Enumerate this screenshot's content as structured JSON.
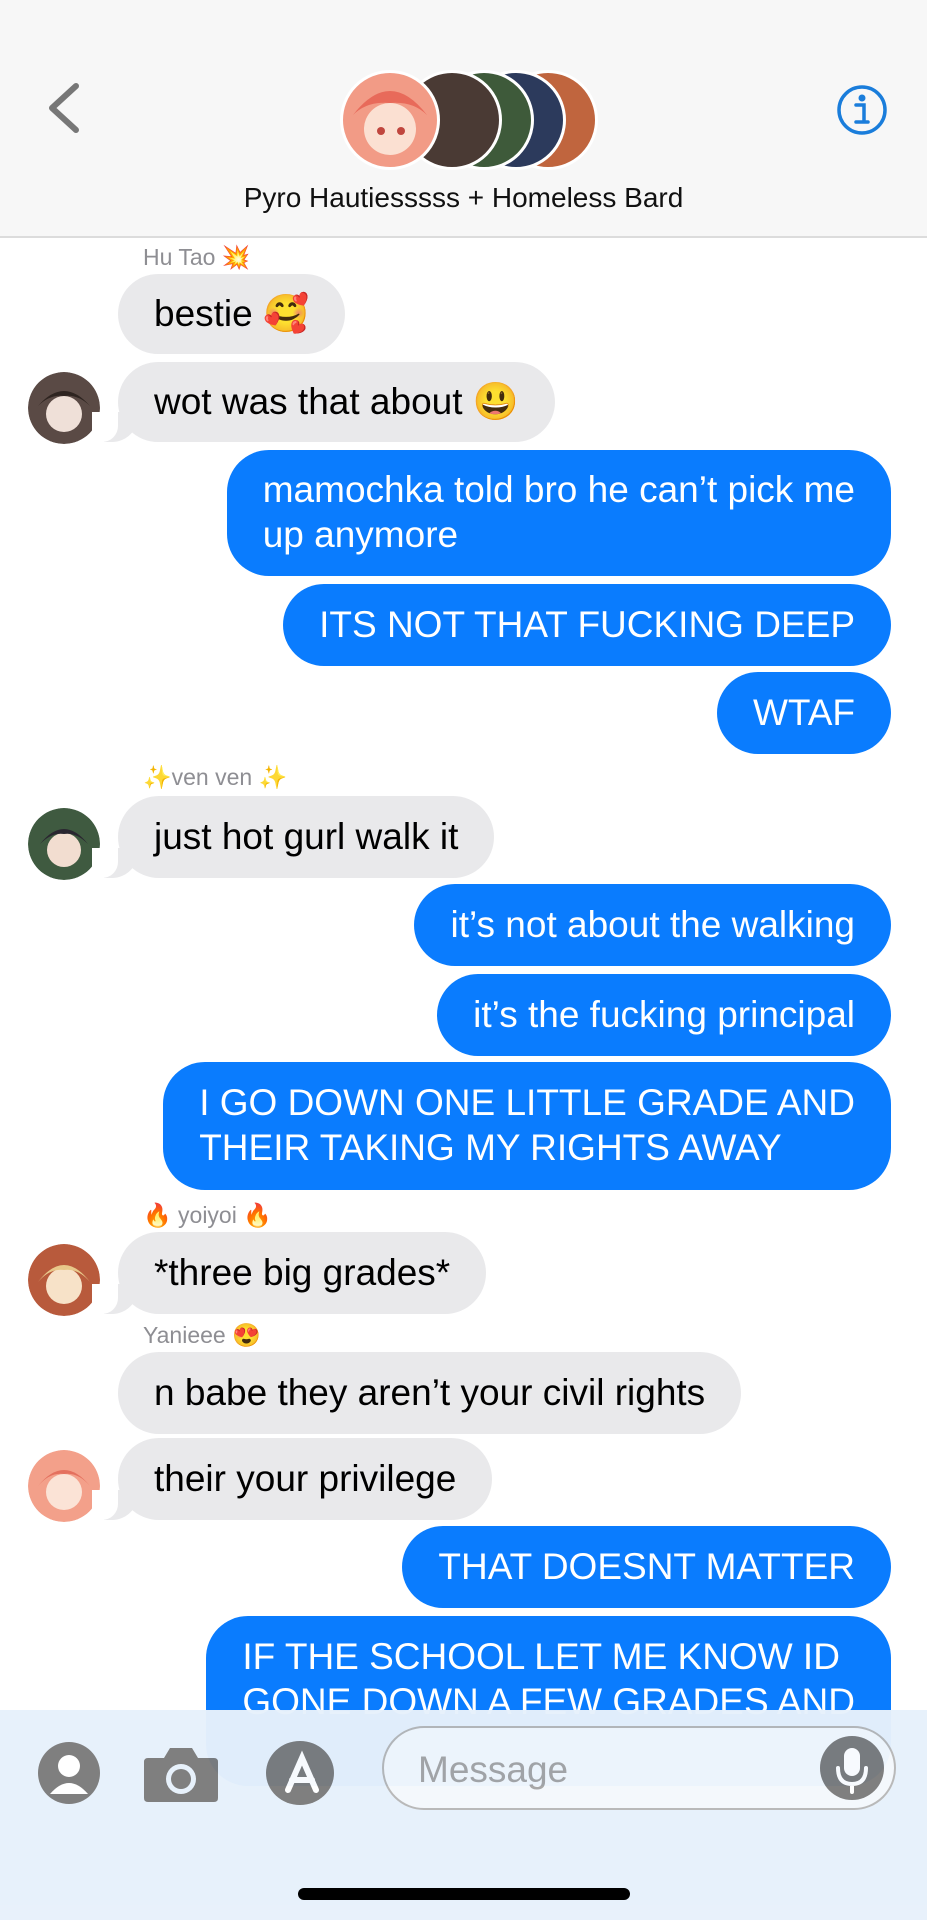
{
  "header": {
    "title": "Pyro Hautiesssss + Homeless Bard",
    "back_icon": "chevron-left-icon",
    "info_icon": "info-icon",
    "accent": "#1a7ddb"
  },
  "colors": {
    "outgoing": "#0a7cfe",
    "incoming": "#e9e9eb",
    "sender_label": "#8e8e93"
  },
  "messages": [
    {
      "sender": "Hu Tao 💥"
    },
    {
      "text": "bestie 🥰"
    },
    {
      "text": "wot was that about 😃"
    },
    {
      "line1": "mamochka told bro he can’t pick me",
      "line2": "up anymore"
    },
    {
      "text": "ITS NOT THAT FUCKING DEEP"
    },
    {
      "text": "WTAF"
    },
    {
      "sender": "✨ven ven ✨"
    },
    {
      "text": "just hot gurl walk it"
    },
    {
      "text": "it’s not about the walking"
    },
    {
      "text": "it’s the fucking principal"
    },
    {
      "line1": "I GO DOWN ONE LITTLE GRADE AND",
      "line2": "THEIR TAKING MY RIGHTS AWAY"
    },
    {
      "sender": "🔥 yoiyoi 🔥"
    },
    {
      "text": "*three big grades*"
    },
    {
      "sender": "Yanieee 😍"
    },
    {
      "text": "n babe they aren’t your civil rights"
    },
    {
      "text": "their your privilege"
    },
    {
      "text": "THAT DOESNT MATTER"
    },
    {
      "line1": "IF THE SCHOOL LET ME KNOW ID",
      "line2": "GONE DOWN A FEW GRADES AND"
    }
  ],
  "composer": {
    "placeholder": "Message",
    "icons": [
      "contact-icon",
      "camera-icon",
      "app-store-icon",
      "microphone-icon"
    ]
  }
}
